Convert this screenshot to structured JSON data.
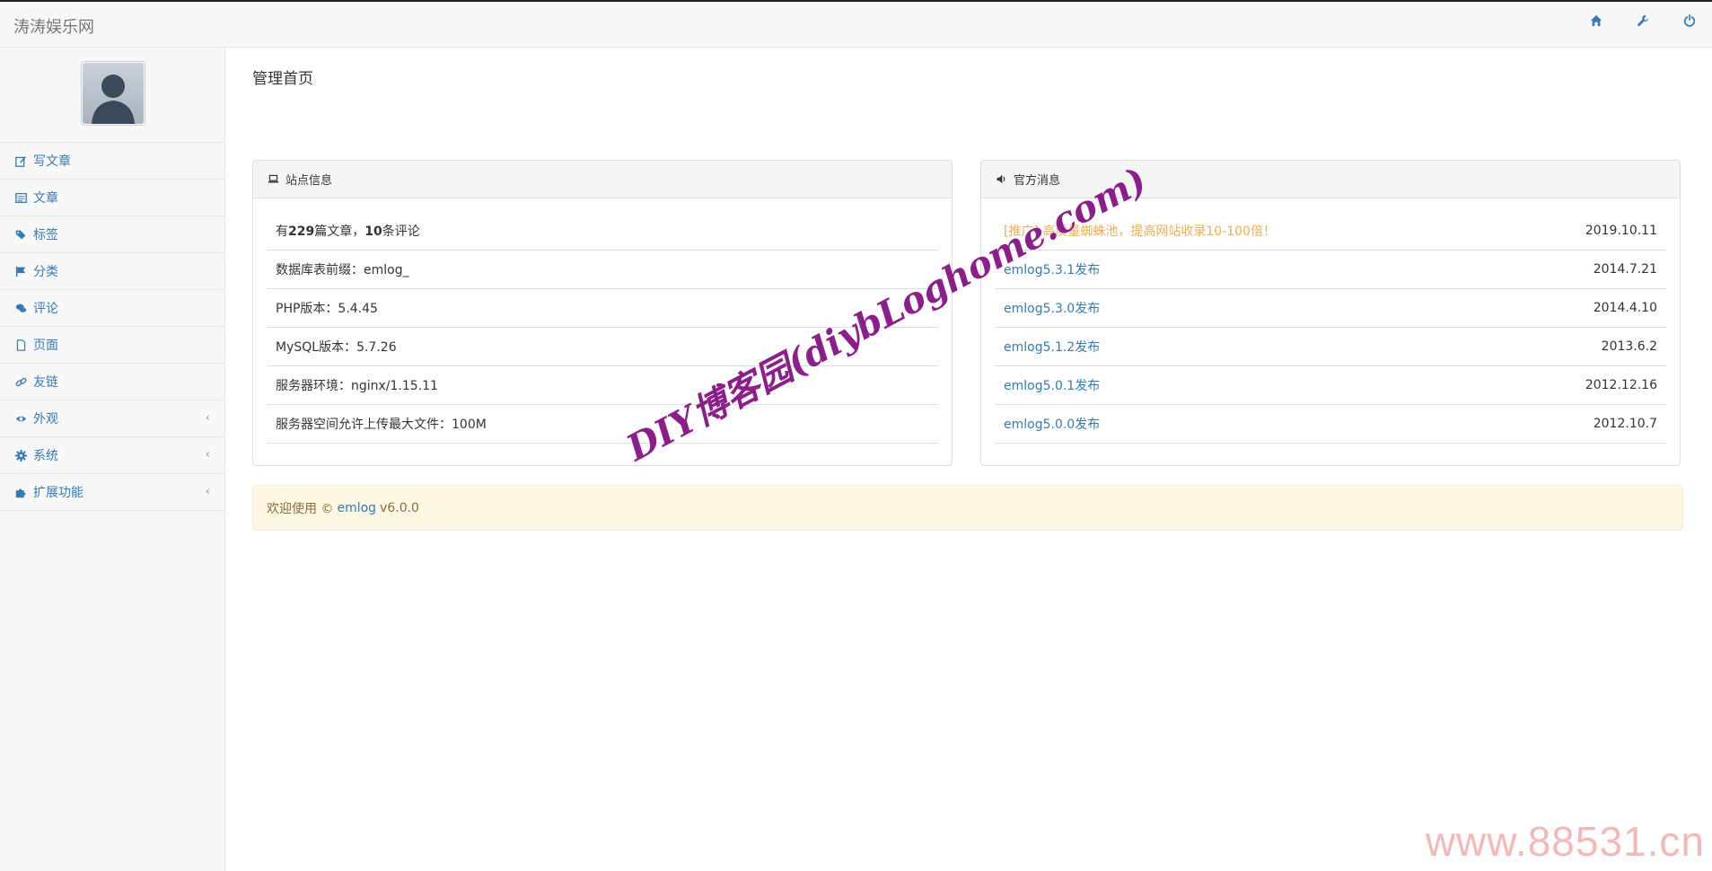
{
  "header": {
    "brand": "涛涛娱乐网",
    "icons": [
      "home-icon",
      "wrench-icon",
      "power-icon"
    ]
  },
  "sidebar": {
    "items": [
      {
        "label": "写文章",
        "icon": "edit-icon",
        "has_children": false
      },
      {
        "label": "文章",
        "icon": "list-icon",
        "has_children": false
      },
      {
        "label": "标签",
        "icon": "tags-icon",
        "has_children": false
      },
      {
        "label": "分类",
        "icon": "flag-icon",
        "has_children": false
      },
      {
        "label": "评论",
        "icon": "comments-icon",
        "has_children": false
      },
      {
        "label": "页面",
        "icon": "file-icon",
        "has_children": false
      },
      {
        "label": "友链",
        "icon": "link-icon",
        "has_children": false
      },
      {
        "label": "外观",
        "icon": "eye-icon",
        "has_children": true
      },
      {
        "label": "系统",
        "icon": "cog-icon",
        "has_children": true
      },
      {
        "label": "扩展功能",
        "icon": "puzzle-icon",
        "has_children": true
      }
    ],
    "chevron": "‹"
  },
  "main": {
    "title": "管理首页",
    "site_info": {
      "heading": "站点信息",
      "stats": {
        "prefix": "有",
        "posts": "229",
        "mid": "篇文章，",
        "comments": "10",
        "suffix": "条评论"
      },
      "rows": [
        "数据库表前缀：emlog_",
        "PHP版本：5.4.45",
        "MySQL版本：5.7.26",
        "服务器环境：nginx/1.15.11",
        "服务器空间允许上传最大文件：100M"
      ]
    },
    "news": {
      "heading": "官方消息",
      "items": [
        {
          "title": "[推广] 高质量蜘蛛池，提高网站收录10-100倍！",
          "date": "2019.10.11",
          "promo": true
        },
        {
          "title": "emlog5.3.1发布",
          "date": "2014.7.21",
          "promo": false
        },
        {
          "title": "emlog5.3.0发布",
          "date": "2014.4.10",
          "promo": false
        },
        {
          "title": "emlog5.1.2发布",
          "date": "2013.6.2",
          "promo": false
        },
        {
          "title": "emlog5.0.1发布",
          "date": "2012.12.16",
          "promo": false
        },
        {
          "title": "emlog5.0.0发布",
          "date": "2012.10.7",
          "promo": false
        }
      ]
    },
    "welcome": {
      "prefix": "欢迎使用 ©",
      "link": "emlog",
      "version": "v6.0.0"
    }
  },
  "watermarks": {
    "diagonal": "DIY博客园(diybLoghome.com)",
    "corner": "www.88531.cn"
  },
  "colors": {
    "link": "#337ab7",
    "promo": "#f0ad4e",
    "welcome_bg": "#fcf8e3",
    "watermark": "#8b1e8b",
    "corner_watermark": "#f4b8b8"
  }
}
